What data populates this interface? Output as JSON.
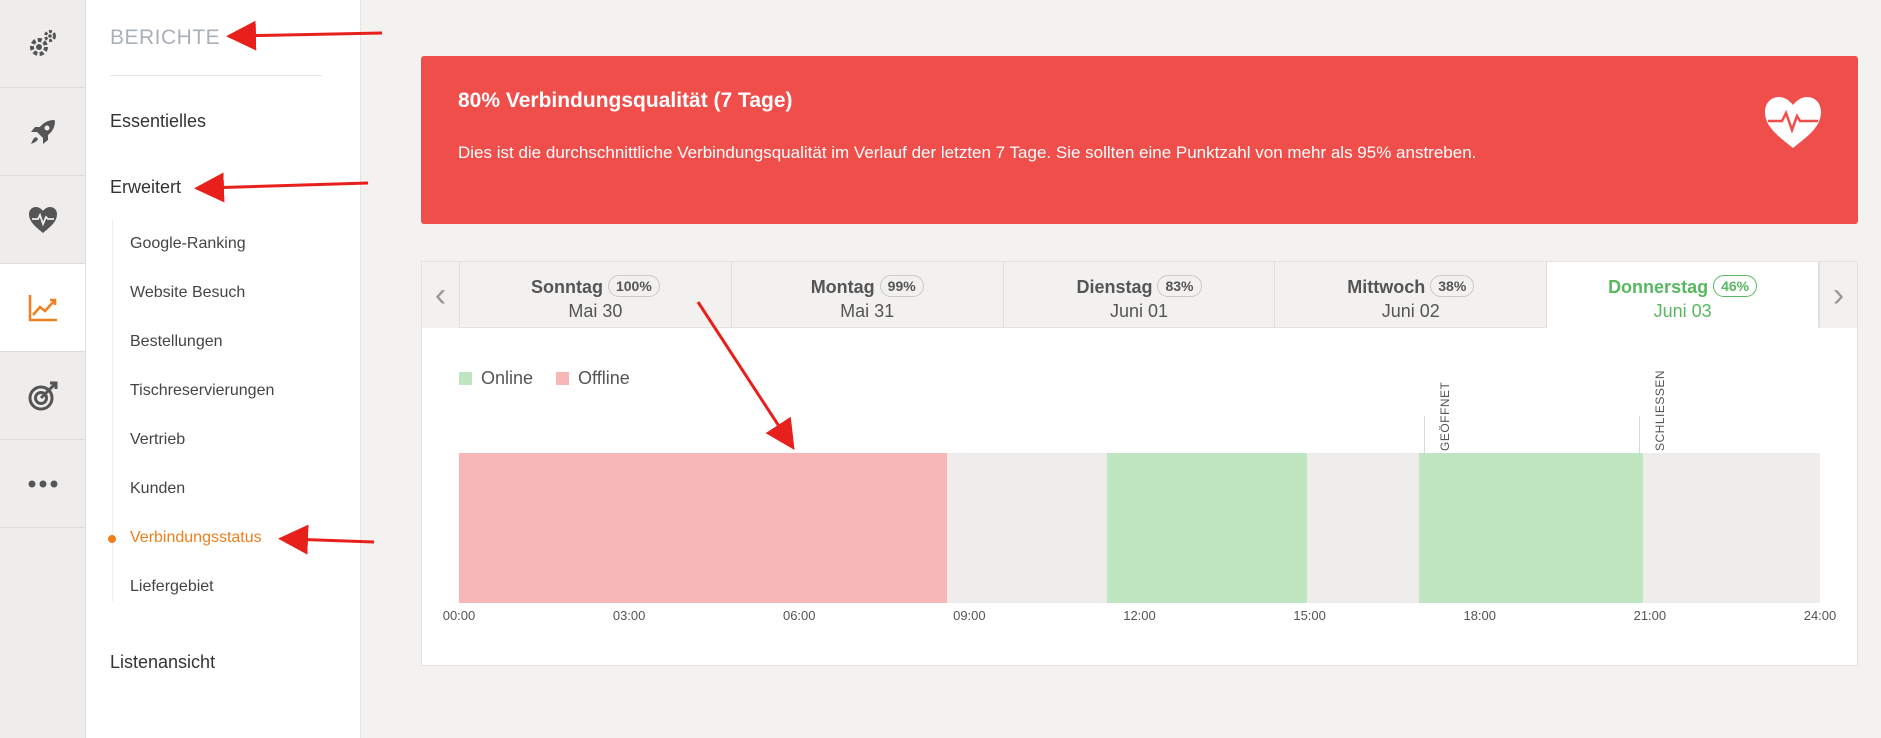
{
  "rail": {
    "items": [
      {
        "icon": "gears-icon",
        "active": false
      },
      {
        "icon": "rocket-icon",
        "active": false
      },
      {
        "icon": "heart-pulse-icon",
        "active": false
      },
      {
        "icon": "chart-line-icon",
        "active": true
      },
      {
        "icon": "target-icon",
        "active": false
      },
      {
        "icon": "more-icon",
        "active": false
      }
    ]
  },
  "subnav": {
    "title": "BERICHTE",
    "essentials": "Essentielles",
    "advanced": "Erweitert",
    "items": [
      {
        "label": "Google-Ranking"
      },
      {
        "label": "Website Besuch"
      },
      {
        "label": "Bestellungen"
      },
      {
        "label": "Tischreservierungen"
      },
      {
        "label": "Vertrieb"
      },
      {
        "label": "Kunden"
      },
      {
        "label": "Verbindungsstatus",
        "active": true
      },
      {
        "label": "Liefergebiet"
      }
    ],
    "list_view": "Listenansicht"
  },
  "alert": {
    "title": "80% Verbindungsqualität (7 Tage)",
    "text": "Dies ist die durchschnittliche Verbindungsqualität im Verlauf der letzten 7 Tage. Sie sollten eine Punktzahl von mehr als 95% anstreben.",
    "icon": "heart-pulse-icon"
  },
  "tabs": [
    {
      "day": "Sonntag",
      "pct": "100%",
      "date": "Mai 30"
    },
    {
      "day": "Montag",
      "pct": "99%",
      "date": "Mai 31"
    },
    {
      "day": "Dienstag",
      "pct": "83%",
      "date": "Juni 01"
    },
    {
      "day": "Mittwoch",
      "pct": "38%",
      "date": "Juni 02"
    },
    {
      "day": "Donnerstag",
      "pct": "46%",
      "date": "Juni 03",
      "active": true
    }
  ],
  "chart_data": {
    "type": "timeline",
    "legend": [
      {
        "name": "Online",
        "color": "#bfe6c1"
      },
      {
        "name": "Offline",
        "color": "#f8b7b7"
      }
    ],
    "x_range": [
      "00:00",
      "24:00"
    ],
    "ticks": [
      "00:00",
      "03:00",
      "06:00",
      "09:00",
      "12:00",
      "15:00",
      "18:00",
      "21:00",
      "24:00"
    ],
    "segments": [
      {
        "status": "Offline",
        "start": 0,
        "end": 8.6
      },
      {
        "status": "Online",
        "start": 11.42,
        "end": 14.95
      },
      {
        "status": "Online",
        "start": 16.93,
        "end": 20.88
      }
    ],
    "markers": [
      {
        "label": "GEÖFFNET",
        "hour": 17.02
      },
      {
        "label": "SCHLIESSEN",
        "hour": 20.8
      }
    ]
  },
  "colors": {
    "accent": "#f07f1e",
    "alert": "#f04e4b",
    "online": "#bfe6c1",
    "offline": "#f8b7b7",
    "active_tab": "#58b860"
  }
}
